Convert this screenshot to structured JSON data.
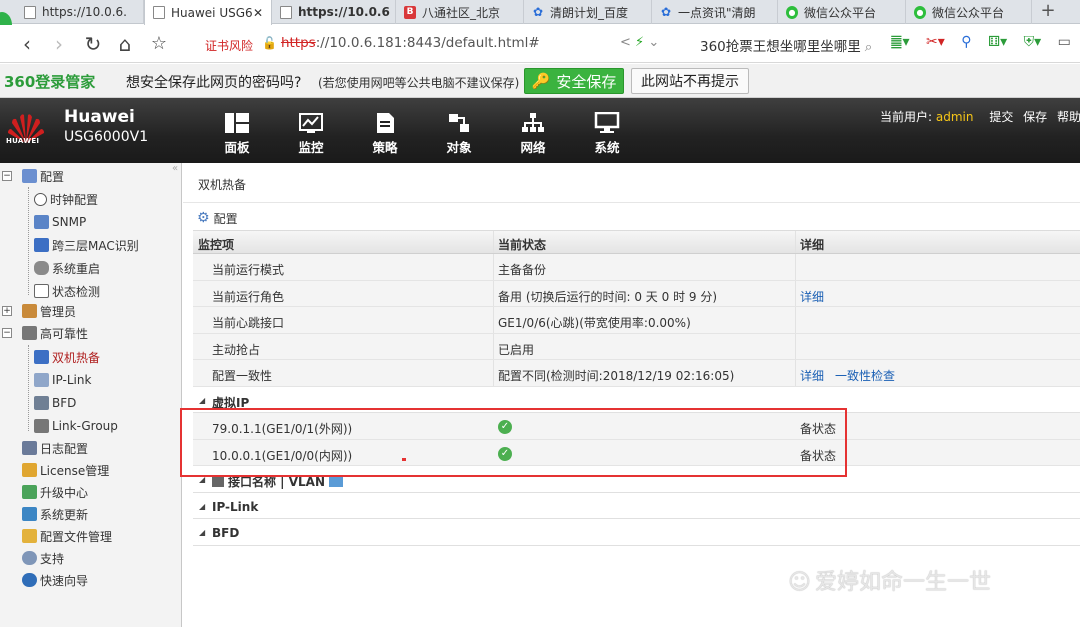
{
  "browser": {
    "tabs": [
      {
        "title": "https://10.0.6.",
        "icon": "page-icon"
      },
      {
        "title": "Huawei USG6",
        "icon": "page-icon"
      },
      {
        "title": "https://10.0.6",
        "icon": "page-icon"
      },
      {
        "title": "八通社区_北京",
        "icon": "b-logo-icon"
      },
      {
        "title": "清朗计划_百度",
        "icon": "paw-icon"
      },
      {
        "title": "一点资讯\"清朗",
        "icon": "paw-icon"
      },
      {
        "title": "微信公众平台",
        "icon": "wechat-icon"
      },
      {
        "title": "微信公众平台",
        "icon": "wechat-icon"
      }
    ],
    "cert_warning": "证书风险",
    "url_protocol": "https",
    "url_rest": "://10.0.6.181:8443/default.html#",
    "search_text": "360抢票王想坐哪里坐哪里"
  },
  "password_bar": {
    "logo": "360登录管家",
    "question": "想安全保存此网页的密码吗?",
    "note": "(若您使用网吧等公共电脑不建议保存)",
    "save_label": "安全保存",
    "never_label": "此网站不再提示"
  },
  "header": {
    "brand": "Huawei",
    "model": "USG6000V1",
    "logo_text": "HUAWEI",
    "menu": [
      "面板",
      "监控",
      "策略",
      "对象",
      "网络",
      "系统"
    ],
    "current_user_label": "当前用户:",
    "username": "admin",
    "actions": [
      "提交",
      "保存",
      "帮助"
    ]
  },
  "sidebar": {
    "items": [
      {
        "label": "配置",
        "icon": "config-icon"
      },
      {
        "label": "时钟配置",
        "icon": "clock-icon"
      },
      {
        "label": "SNMP",
        "icon": "snmp-icon"
      },
      {
        "label": "跨三层MAC识别",
        "icon": "monitor-icon"
      },
      {
        "label": "系统重启",
        "icon": "restart-icon"
      },
      {
        "label": "状态检测",
        "icon": "status-check-icon"
      },
      {
        "label": "管理员",
        "icon": "admin-icon"
      },
      {
        "label": "高可靠性",
        "icon": "ha-icon"
      },
      {
        "label": "双机热备",
        "icon": "hot-standby-icon"
      },
      {
        "label": "IP-Link",
        "icon": "ip-link-icon"
      },
      {
        "label": "BFD",
        "icon": "bfd-icon"
      },
      {
        "label": "Link-Group",
        "icon": "link-group-icon"
      },
      {
        "label": "日志配置",
        "icon": "log-icon"
      },
      {
        "label": "License管理",
        "icon": "license-icon"
      },
      {
        "label": "升级中心",
        "icon": "upgrade-icon"
      },
      {
        "label": "系统更新",
        "icon": "update-icon"
      },
      {
        "label": "配置文件管理",
        "icon": "config-file-icon"
      },
      {
        "label": "支持",
        "icon": "support-icon"
      },
      {
        "label": "快速向导",
        "icon": "wizard-icon"
      }
    ]
  },
  "main": {
    "breadcrumb": "双机热备",
    "config_label": "配置",
    "columns": [
      "监控项",
      "当前状态",
      "详细"
    ],
    "rows": [
      {
        "item": "当前运行模式",
        "status": "主备备份",
        "detail": ""
      },
      {
        "item": "当前运行角色",
        "status": "备用 (切换后运行的时间: 0 天 0 时 9 分)",
        "detail": "详细"
      },
      {
        "item": "当前心跳接口",
        "status": "GE1/0/6(心跳)(带宽使用率:0.00%)",
        "detail": ""
      },
      {
        "item": "主动抢占",
        "status": "已启用",
        "detail": ""
      },
      {
        "item": "配置一致性",
        "status": "配置不同(检测时间:2018/12/19 02:16:05)",
        "detail": "详细",
        "detail2": "一致性检查"
      }
    ],
    "sections": {
      "virtual_ip": "虚拟IP",
      "interface": "接口名称 | VLAN",
      "ip_link": "IP-Link",
      "bfd": "BFD"
    },
    "vip_rows": [
      {
        "name": "79.0.1.1(GE1/0/1(外网))",
        "state": "备状态"
      },
      {
        "name": "10.0.0.1(GE1/0/0(内网))",
        "state": "备状态"
      }
    ]
  },
  "watermark": "爱婷如命一生一世",
  "colors": {
    "accent_green": "#3bb33f",
    "huawei_red": "#cf1f1f",
    "link_blue": "#1a5fb4",
    "annotation_red": "#e53232"
  }
}
